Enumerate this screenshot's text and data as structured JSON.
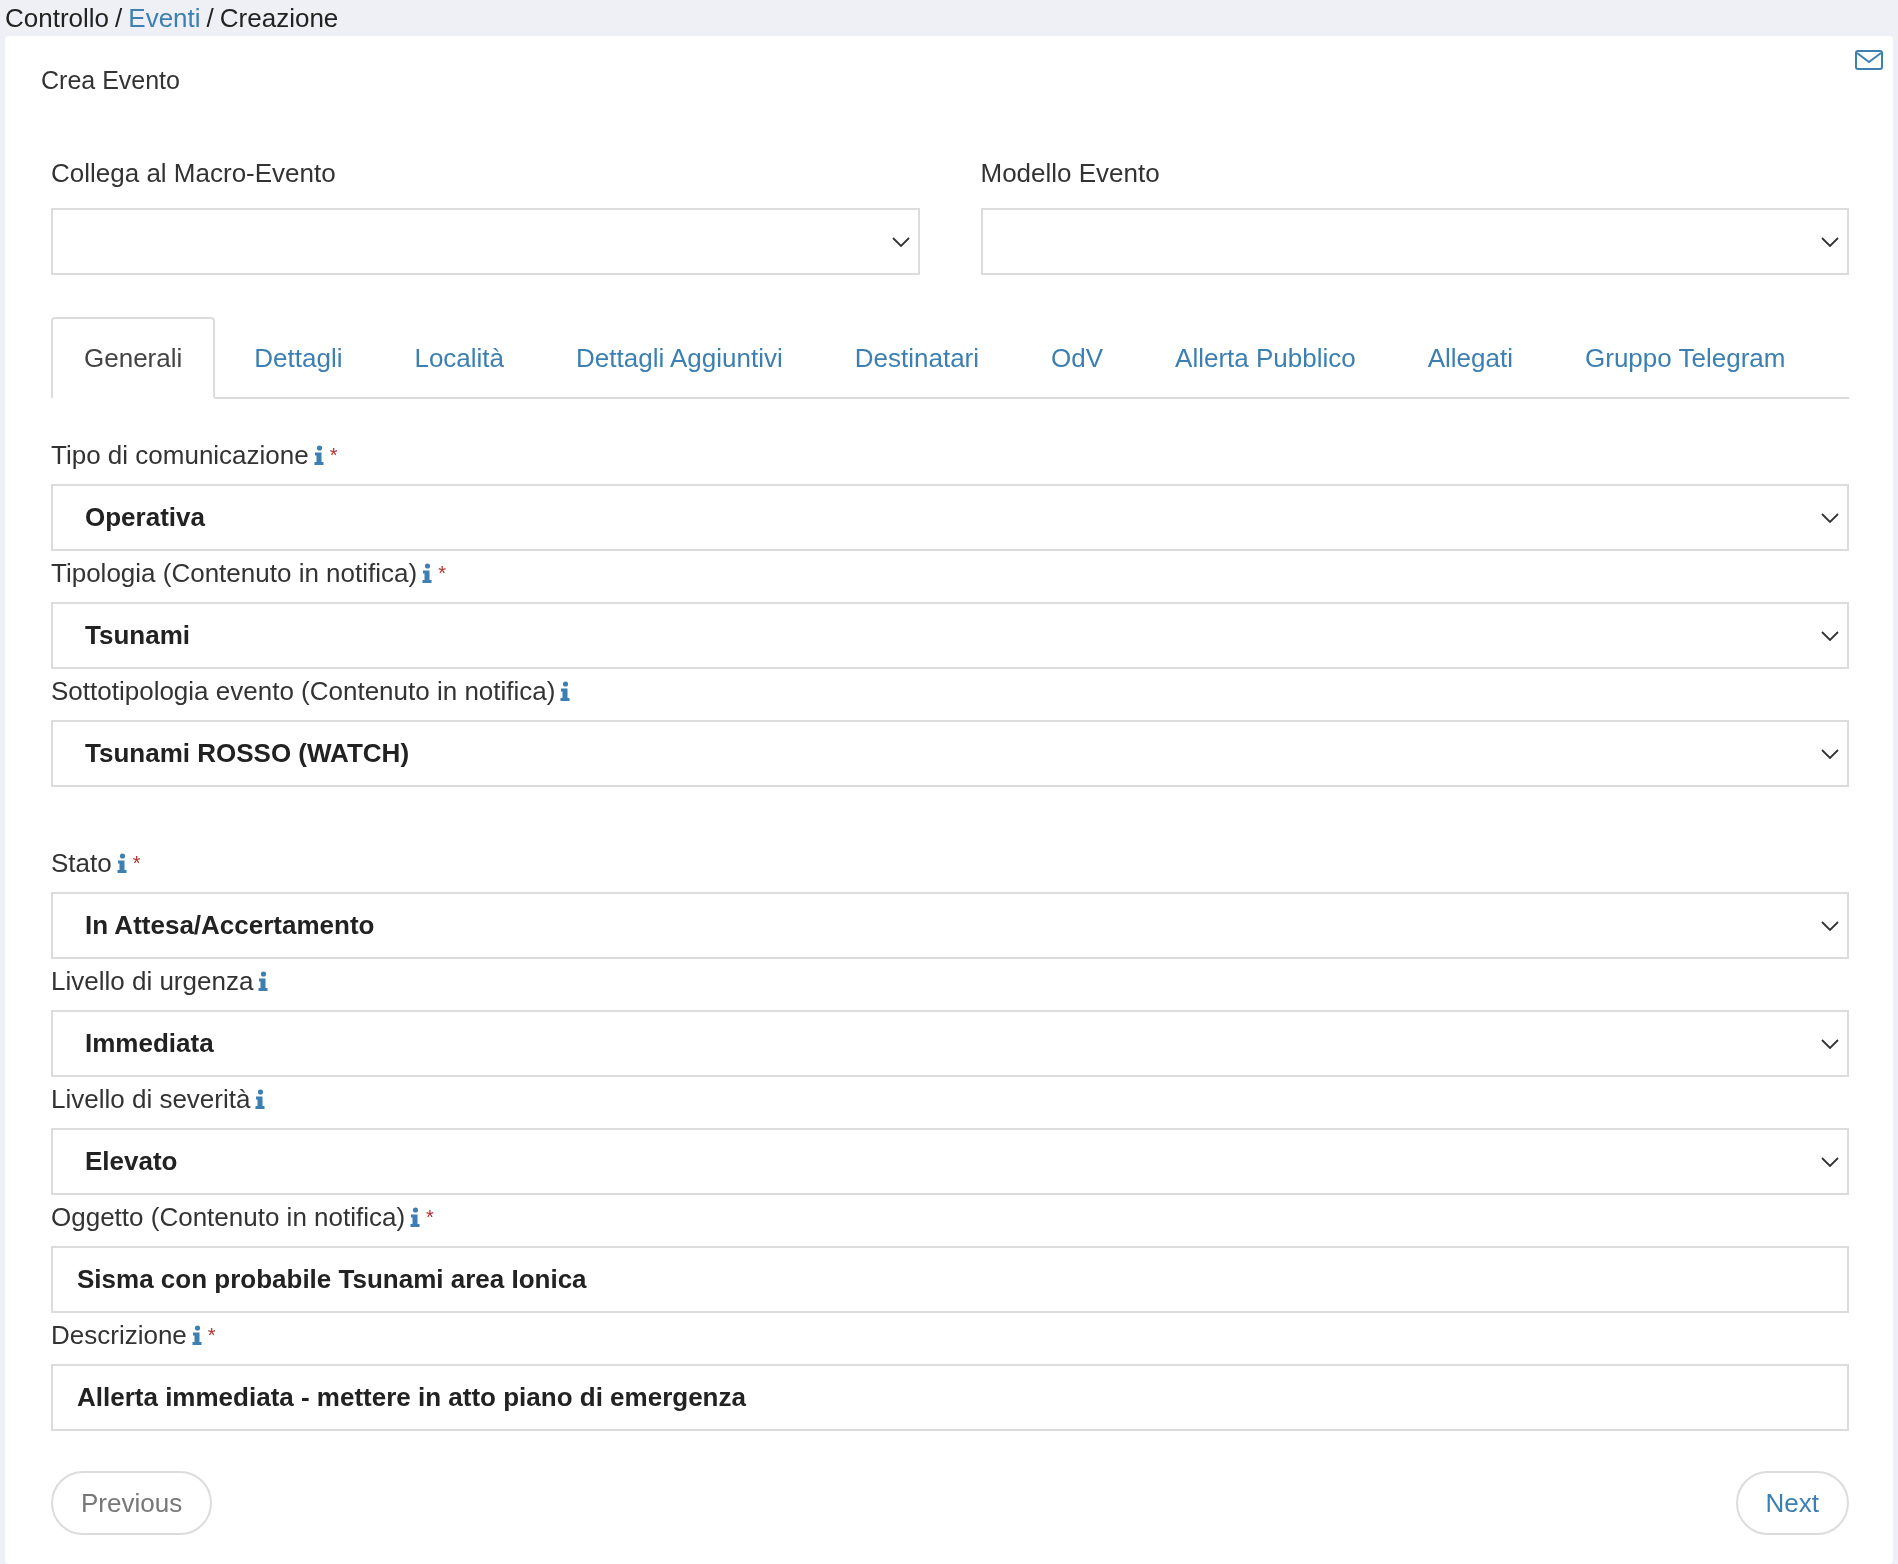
{
  "breadcrumb": [
    {
      "kind": "text",
      "label": "Controllo"
    },
    {
      "kind": "separator",
      "label": "/"
    },
    {
      "kind": "link",
      "label": "Eventi"
    },
    {
      "kind": "separator",
      "label": "/"
    },
    {
      "kind": "text",
      "label": "Creazione"
    }
  ],
  "card": {
    "title": "Crea Evento"
  },
  "top_fields": [
    {
      "label": "Collega al Macro-Evento"
    },
    {
      "label": "Modello Evento"
    }
  ],
  "tabs": [
    {
      "label": "Generali",
      "selected": true
    },
    {
      "label": "Dettagli",
      "selected": false
    },
    {
      "label": "Località",
      "selected": false
    },
    {
      "label": "Dettagli Aggiuntivi",
      "selected": false
    },
    {
      "label": "Destinatari",
      "selected": false
    },
    {
      "label": "OdV",
      "selected": false
    },
    {
      "label": "Allerta Pubblico",
      "selected": false
    },
    {
      "label": "Allegati",
      "selected": false
    },
    {
      "label": "Gruppo Telegram",
      "selected": false
    }
  ],
  "form_sections": [
    [
      {
        "kind": "select",
        "label": "Tipo di comunicazione",
        "required_mark": "*",
        "value": "Operativa"
      },
      {
        "kind": "select",
        "label": "Tipologia (Contenuto in notifica)",
        "required_mark": "*",
        "value": "Tsunami"
      },
      {
        "kind": "select",
        "label": "Sottotipologia evento (Contenuto in notifica)",
        "value": "Tsunami ROSSO (WATCH)"
      }
    ],
    [
      {
        "kind": "select",
        "label": "Stato",
        "required_mark": "*",
        "value": "In Attesa/Accertamento"
      },
      {
        "kind": "select",
        "label": "Livello di urgenza",
        "value": "Immediata"
      },
      {
        "kind": "select",
        "label": "Livello di severità",
        "value": "Elevato"
      },
      {
        "kind": "text",
        "label": "Oggetto (Contenuto in notifica)",
        "required_mark": "*",
        "value": "Sisma con probabile Tsunami area Ionica"
      },
      {
        "kind": "text",
        "label": "Descrizione",
        "required_mark": "*",
        "value": "Allerta immediata - mettere in atto piano di emergenza"
      }
    ]
  ],
  "buttons": {
    "previous": "Previous",
    "next": "Next"
  }
}
